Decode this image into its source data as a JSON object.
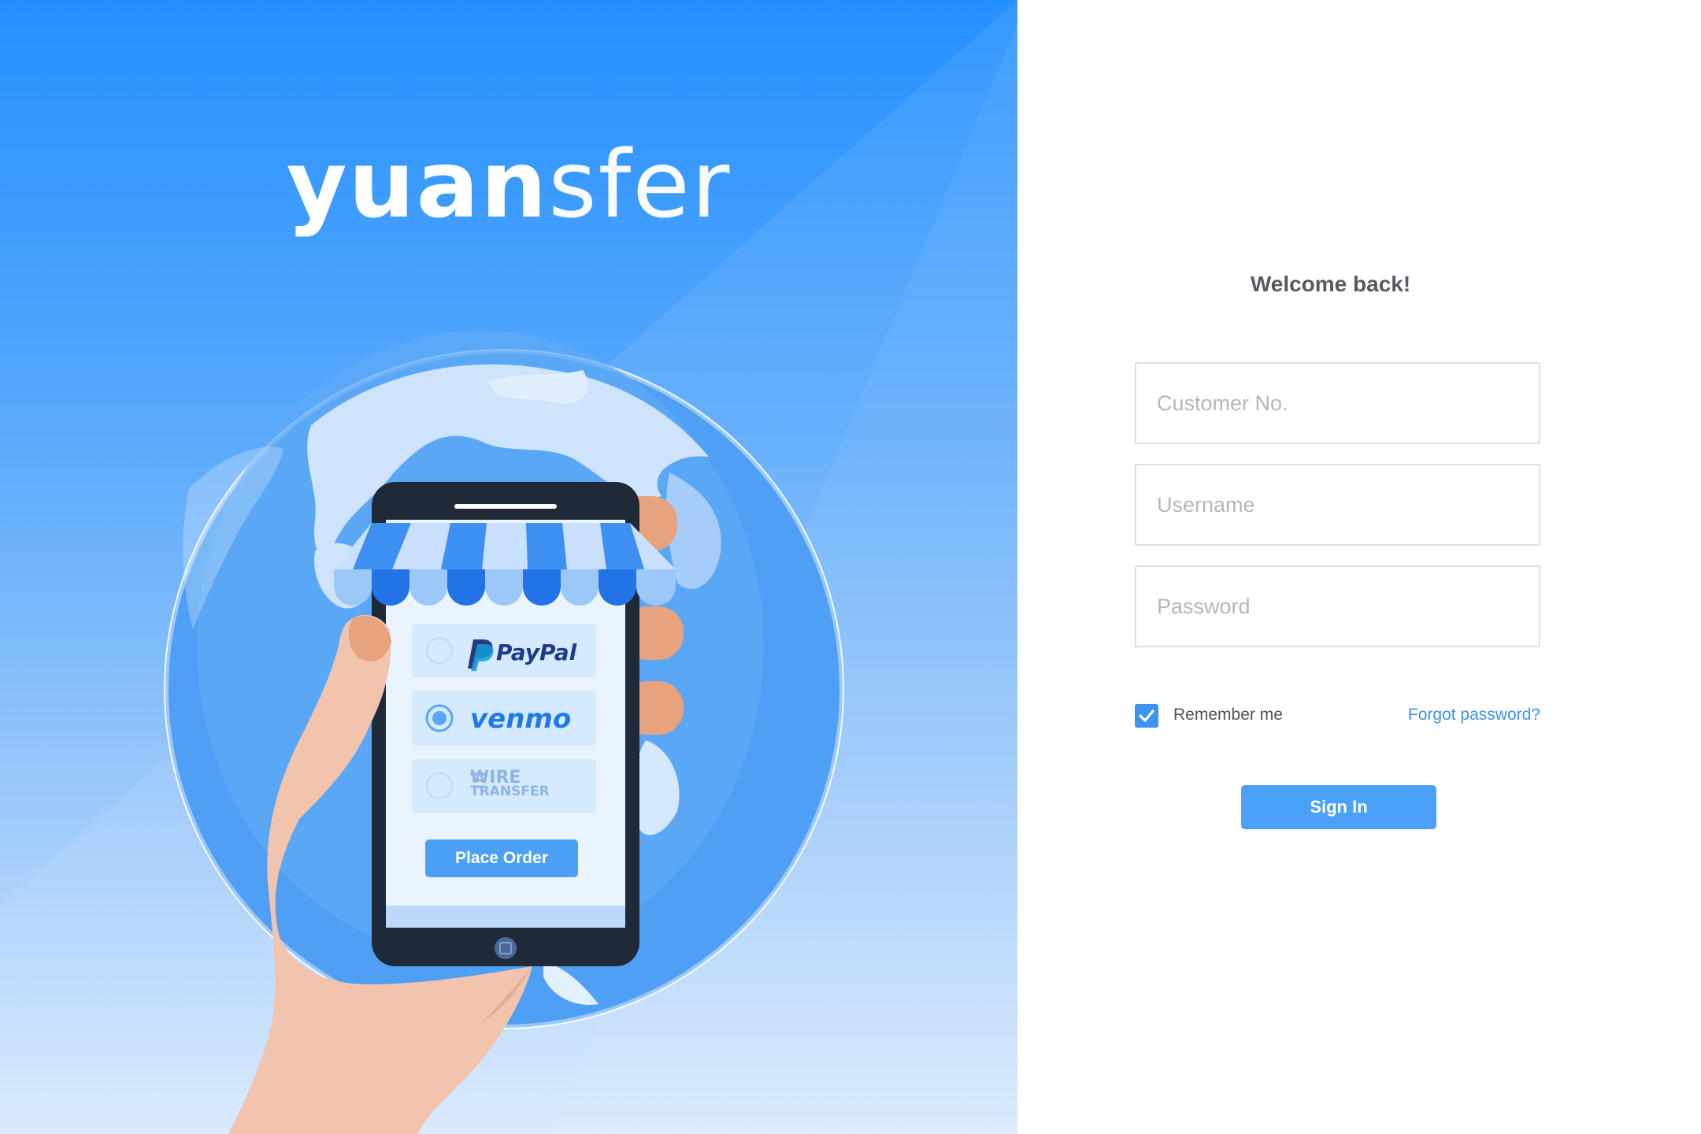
{
  "brand": {
    "logo_bold": "yuan",
    "logo_light": "sfer"
  },
  "illustration": {
    "payment_options": [
      {
        "label": "PayPal",
        "selected": false
      },
      {
        "label": "venmo",
        "selected": true
      },
      {
        "label_line1": "WIRE",
        "label_line2": "TRANSFER",
        "selected": false
      }
    ],
    "place_order_label": "Place Order"
  },
  "login": {
    "welcome": "Welcome back!",
    "customer_no_placeholder": "Customer No.",
    "username_placeholder": "Username",
    "password_placeholder": "Password",
    "remember_label": "Remember me",
    "remember_checked": true,
    "forgot_label": "Forgot password?",
    "signin_label": "Sign In"
  },
  "colors": {
    "accent": "#3d93f0",
    "hero_top": "#2490ff",
    "hero_bottom": "#d7e9fd"
  }
}
